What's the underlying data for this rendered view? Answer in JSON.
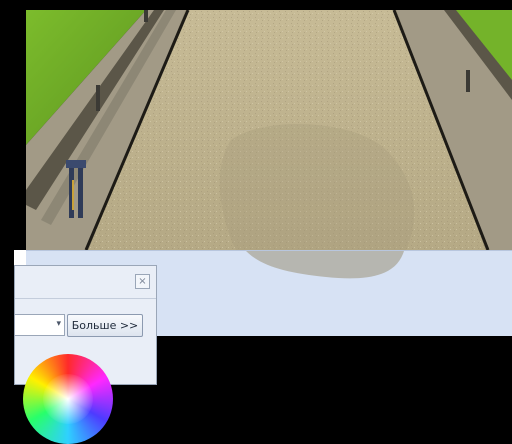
{
  "colors": {
    "grass": "#6aa724",
    "road": "#bcb08f",
    "panel": "#d7e2f4",
    "frame": "#000000"
  },
  "dialog": {
    "close_label": "×",
    "combo_arrow": "▾",
    "more_button_label": "Больше >>"
  }
}
